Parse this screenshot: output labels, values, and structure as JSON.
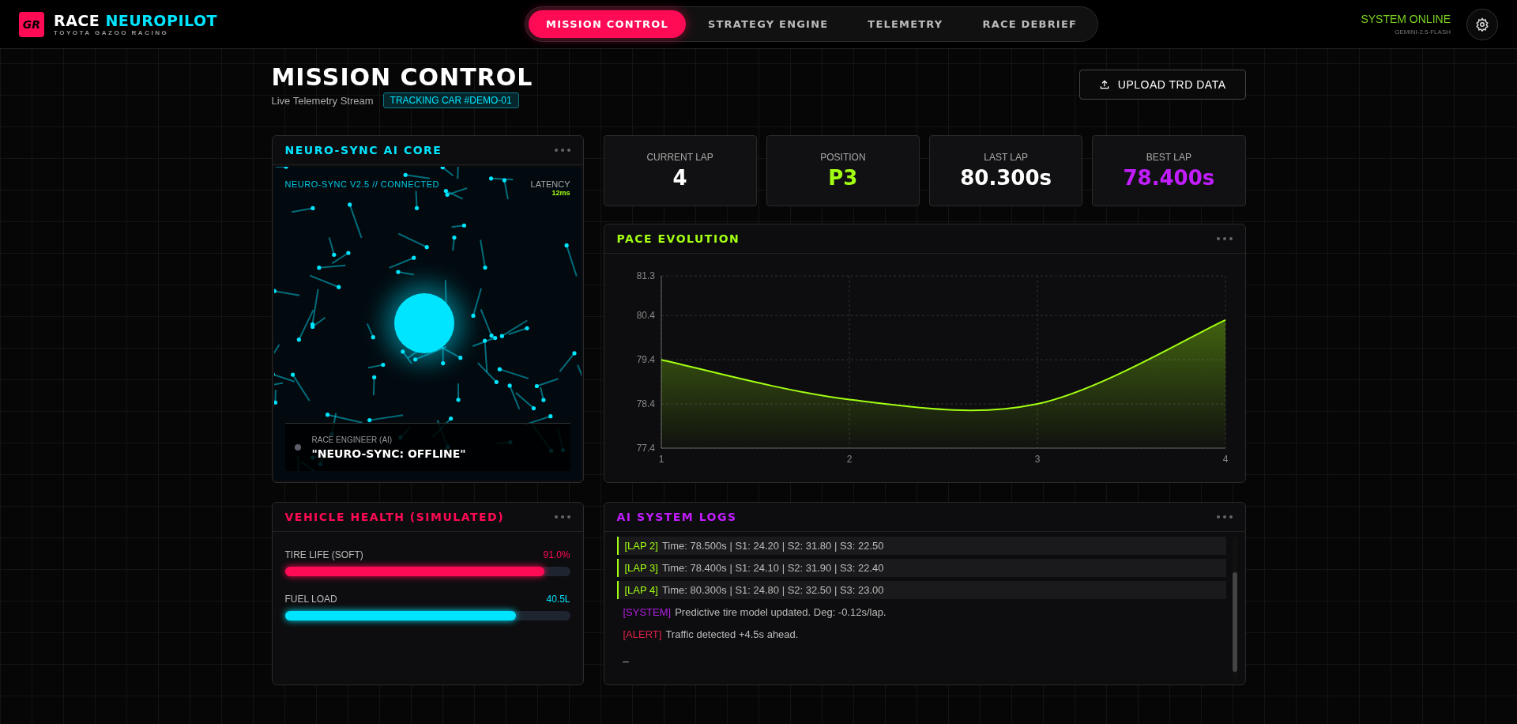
{
  "brand": {
    "logo": "GR",
    "name": "RACE",
    "accent": "NEUROPILOT",
    "subtitle": "TOYOTA GAZOO RACING"
  },
  "tabs": [
    {
      "label": "MISSION CONTROL",
      "selected": true
    },
    {
      "label": "STRATEGY ENGINE",
      "selected": false
    },
    {
      "label": "TELEMETRY",
      "selected": false
    },
    {
      "label": "RACE DEBRIEF",
      "selected": false
    }
  ],
  "status": {
    "text": "SYSTEM ONLINE",
    "model": "GEMINI-2.5-FLASH"
  },
  "page": {
    "title": "MISSION CONTROL",
    "subtitle": "Live Telemetry Stream",
    "badge": "TRACKING CAR #DEMO-01",
    "upload_button": "UPLOAD TRD DATA"
  },
  "ai_core": {
    "title": "NEURO-SYNC AI CORE",
    "connection": "NEURO-SYNC V2.5 // CONNECTED",
    "latency_label": "LATENCY",
    "latency": "12ms",
    "engineer_label": "RACE ENGINEER (AI)",
    "message": "\"NEURO-SYNC: OFFLINE\"",
    "online": false
  },
  "stats": [
    {
      "label": "CURRENT LAP",
      "value": "4",
      "color": "#ffffff"
    },
    {
      "label": "POSITION",
      "value": "P3",
      "color": "#a3ff12"
    },
    {
      "label": "LAST LAP",
      "value": "80.300s",
      "color": "#ffffff"
    },
    {
      "label": "BEST LAP",
      "value": "78.400s",
      "color": "#c21dff"
    }
  ],
  "pace": {
    "title": "PACE EVOLUTION",
    "chart_data": {
      "type": "area",
      "x": [
        1,
        2,
        3,
        4
      ],
      "series": [
        {
          "color": "#a3ff12",
          "values": [
            79.4,
            78.5,
            78.4,
            80.3
          ]
        }
      ],
      "xlim": [
        1,
        4
      ],
      "grid": true,
      "xticks": [
        1,
        2,
        3,
        4
      ],
      "ylim": [
        77.4,
        81.3
      ],
      "yticks": [
        {
          "value": 77.4,
          "label": "77.4"
        },
        {
          "value": 78.4,
          "label": "78.4"
        },
        {
          "value": 79.4,
          "label": "79.4"
        },
        {
          "value": 80.4,
          "label": "80.4"
        },
        {
          "value": 81.3,
          "label": "81.3"
        }
      ]
    }
  },
  "health": {
    "title": "VEHICLE HEALTH (SIMULATED)",
    "meters": [
      {
        "label": "TIRE LIFE (SOFT)",
        "reading": "91.0%",
        "level": 0.91,
        "color": "#ff0a54"
      },
      {
        "label": "FUEL LOAD",
        "reading": "40.5L",
        "level": 0.81,
        "color": "#00e5ff"
      }
    ]
  },
  "logs": {
    "title": "AI SYSTEM LOGS",
    "entries": [
      {
        "kind": "lap",
        "tag": "[LAP 2]",
        "text": "Time: 78.500s | S1: 24.20 | S2: 31.80 | S3: 22.50"
      },
      {
        "kind": "lap",
        "tag": "[LAP 3]",
        "text": "Time: 78.400s | S1: 24.10 | S2: 31.90 | S3: 22.40"
      },
      {
        "kind": "lap",
        "tag": "[LAP 4]",
        "text": "Time: 80.300s | S1: 24.80 | S2: 32.50 | S3: 23.00"
      },
      {
        "kind": "system",
        "tag": "[SYSTEM]",
        "text": "Predictive tire model updated. Deg: -0.12s/lap."
      },
      {
        "kind": "alert",
        "tag": "[ALERT]",
        "text": "Traffic detected +4.5s ahead."
      }
    ],
    "cursor": "_"
  }
}
